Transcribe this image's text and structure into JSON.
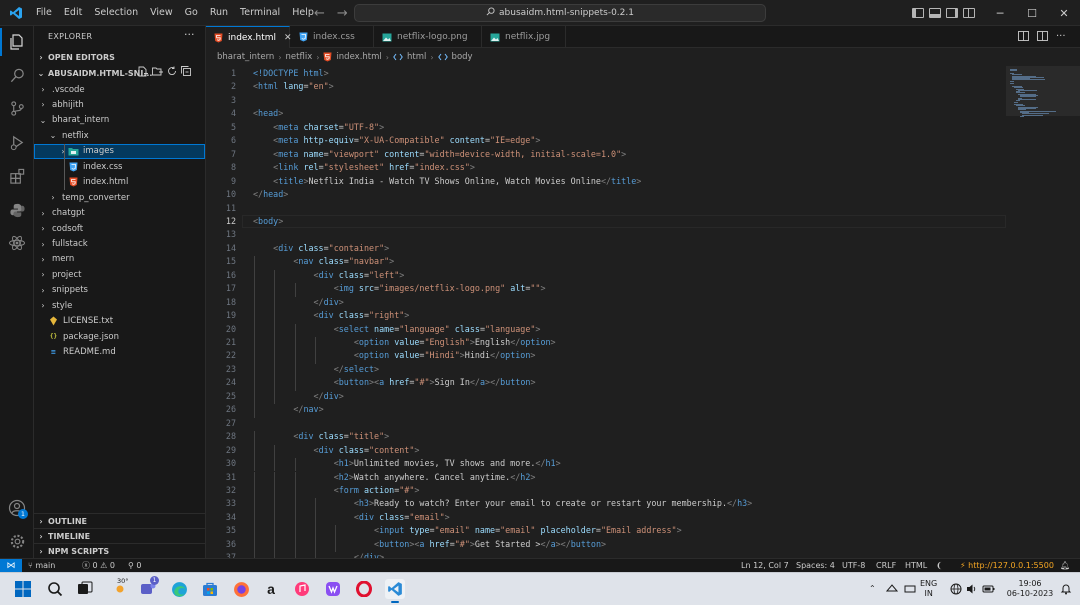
{
  "menu": [
    "File",
    "Edit",
    "Selection",
    "View",
    "Go",
    "Run",
    "Terminal",
    "Help"
  ],
  "command_center": "abusaidm.html-snippets-0.2.1",
  "sidebar": {
    "title": "EXPLORER",
    "open_editors": "OPEN EDITORS",
    "root": "ABUSAIDM.HTML-SNI...",
    "tree": [
      {
        "label": ".vscode",
        "kind": "folder",
        "depth": 1,
        "open": false
      },
      {
        "label": "abhijith",
        "kind": "folder",
        "depth": 1,
        "open": false
      },
      {
        "label": "bharat_intern",
        "kind": "folder",
        "depth": 1,
        "open": true
      },
      {
        "label": "netflix",
        "kind": "folder",
        "depth": 2,
        "open": true
      },
      {
        "label": "images",
        "kind": "images",
        "depth": 3,
        "open": false,
        "selected": true
      },
      {
        "label": "index.css",
        "kind": "css",
        "depth": 3
      },
      {
        "label": "index.html",
        "kind": "html",
        "depth": 3
      },
      {
        "label": "temp_converter",
        "kind": "folder",
        "depth": 2,
        "open": false
      },
      {
        "label": "chatgpt",
        "kind": "folder",
        "depth": 1,
        "open": false
      },
      {
        "label": "codsoft",
        "kind": "folder",
        "depth": 1,
        "open": false
      },
      {
        "label": "fullstack",
        "kind": "folder",
        "depth": 1,
        "open": false
      },
      {
        "label": "mern",
        "kind": "folder",
        "depth": 1,
        "open": false
      },
      {
        "label": "project",
        "kind": "folder",
        "depth": 1,
        "open": false
      },
      {
        "label": "snippets",
        "kind": "folder",
        "depth": 1,
        "open": false
      },
      {
        "label": "style",
        "kind": "folder",
        "depth": 1,
        "open": false
      },
      {
        "label": "LICENSE.txt",
        "kind": "license",
        "depth": 1
      },
      {
        "label": "package.json",
        "kind": "json",
        "depth": 1
      },
      {
        "label": "README.md",
        "kind": "md",
        "depth": 1
      }
    ],
    "outline": "OUTLINE",
    "timeline": "TIMELINE",
    "npm_scripts": "NPM SCRIPTS"
  },
  "tabs": [
    {
      "label": "index.html",
      "kind": "html",
      "active": true
    },
    {
      "label": "index.css",
      "kind": "css",
      "active": false
    },
    {
      "label": "netflix-logo.png",
      "kind": "img",
      "active": false
    },
    {
      "label": "netflix.jpg",
      "kind": "img",
      "active": false
    }
  ],
  "breadcrumb": [
    "bharat_intern",
    "netflix",
    "index.html",
    "html",
    "body"
  ],
  "code": [
    [
      [
        "doc",
        "<!DOCTYPE "
      ],
      [
        "tag",
        "html"
      ],
      [
        "brk",
        ">"
      ]
    ],
    [
      [
        "brk",
        "<"
      ],
      [
        "tag",
        "html "
      ],
      [
        "attr",
        "lang"
      ],
      [
        "text",
        "="
      ],
      [
        "str",
        "\"en\""
      ],
      [
        "brk",
        ">"
      ]
    ],
    [],
    [
      [
        "brk",
        "<"
      ],
      [
        "tag",
        "head"
      ],
      [
        "brk",
        ">"
      ]
    ],
    [
      [
        "text",
        "    "
      ],
      [
        "brk",
        "<"
      ],
      [
        "tag",
        "meta "
      ],
      [
        "attr",
        "charset"
      ],
      [
        "text",
        "="
      ],
      [
        "str",
        "\"UTF-8\""
      ],
      [
        "brk",
        ">"
      ]
    ],
    [
      [
        "text",
        "    "
      ],
      [
        "brk",
        "<"
      ],
      [
        "tag",
        "meta "
      ],
      [
        "attr",
        "http-equiv"
      ],
      [
        "text",
        "="
      ],
      [
        "str",
        "\"X-UA-Compatible\""
      ],
      [
        "attr",
        " content"
      ],
      [
        "text",
        "="
      ],
      [
        "str",
        "\"IE=edge\""
      ],
      [
        "brk",
        ">"
      ]
    ],
    [
      [
        "text",
        "    "
      ],
      [
        "brk",
        "<"
      ],
      [
        "tag",
        "meta "
      ],
      [
        "attr",
        "name"
      ],
      [
        "text",
        "="
      ],
      [
        "str",
        "\"viewport\""
      ],
      [
        "attr",
        " content"
      ],
      [
        "text",
        "="
      ],
      [
        "str",
        "\"width=device-width, initial-scale=1.0\""
      ],
      [
        "brk",
        ">"
      ]
    ],
    [
      [
        "text",
        "    "
      ],
      [
        "brk",
        "<"
      ],
      [
        "tag",
        "link "
      ],
      [
        "attr",
        "rel"
      ],
      [
        "text",
        "="
      ],
      [
        "str",
        "\"stylesheet\""
      ],
      [
        "attr",
        " href"
      ],
      [
        "text",
        "="
      ],
      [
        "str",
        "\"index.css\""
      ],
      [
        "brk",
        ">"
      ]
    ],
    [
      [
        "text",
        "    "
      ],
      [
        "brk",
        "<"
      ],
      [
        "tag",
        "title"
      ],
      [
        "brk",
        ">"
      ],
      [
        "text",
        "Netflix India - Watch TV Shows Online, Watch Movies Online"
      ],
      [
        "brk",
        "</"
      ],
      [
        "tag",
        "title"
      ],
      [
        "brk",
        ">"
      ]
    ],
    [
      [
        "brk",
        "</"
      ],
      [
        "tag",
        "head"
      ],
      [
        "brk",
        ">"
      ]
    ],
    [],
    [
      [
        "brk",
        "<"
      ],
      [
        "tag",
        "body"
      ],
      [
        "brk",
        ">"
      ]
    ],
    [],
    [
      [
        "text",
        "    "
      ],
      [
        "brk",
        "<"
      ],
      [
        "tag",
        "div "
      ],
      [
        "attr",
        "class"
      ],
      [
        "text",
        "="
      ],
      [
        "str",
        "\"container\""
      ],
      [
        "brk",
        ">"
      ]
    ],
    [
      [
        "text",
        "        "
      ],
      [
        "brk",
        "<"
      ],
      [
        "tag",
        "nav "
      ],
      [
        "attr",
        "class"
      ],
      [
        "text",
        "="
      ],
      [
        "str",
        "\"navbar\""
      ],
      [
        "brk",
        ">"
      ]
    ],
    [
      [
        "text",
        "            "
      ],
      [
        "brk",
        "<"
      ],
      [
        "tag",
        "div "
      ],
      [
        "attr",
        "class"
      ],
      [
        "text",
        "="
      ],
      [
        "str",
        "\"left\""
      ],
      [
        "brk",
        ">"
      ]
    ],
    [
      [
        "text",
        "                "
      ],
      [
        "brk",
        "<"
      ],
      [
        "tag",
        "img "
      ],
      [
        "attr",
        "src"
      ],
      [
        "text",
        "="
      ],
      [
        "str",
        "\"images/netflix-logo.png\""
      ],
      [
        "attr",
        " alt"
      ],
      [
        "text",
        "="
      ],
      [
        "str",
        "\"\""
      ],
      [
        "brk",
        ">"
      ]
    ],
    [
      [
        "text",
        "            "
      ],
      [
        "brk",
        "</"
      ],
      [
        "tag",
        "div"
      ],
      [
        "brk",
        ">"
      ]
    ],
    [
      [
        "text",
        "            "
      ],
      [
        "brk",
        "<"
      ],
      [
        "tag",
        "div "
      ],
      [
        "attr",
        "class"
      ],
      [
        "text",
        "="
      ],
      [
        "str",
        "\"right\""
      ],
      [
        "brk",
        ">"
      ]
    ],
    [
      [
        "text",
        "                "
      ],
      [
        "brk",
        "<"
      ],
      [
        "tag",
        "select "
      ],
      [
        "attr",
        "name"
      ],
      [
        "text",
        "="
      ],
      [
        "str",
        "\"language\""
      ],
      [
        "attr",
        " class"
      ],
      [
        "text",
        "="
      ],
      [
        "str",
        "\"language\""
      ],
      [
        "brk",
        ">"
      ]
    ],
    [
      [
        "text",
        "                    "
      ],
      [
        "brk",
        "<"
      ],
      [
        "tag",
        "option "
      ],
      [
        "attr",
        "value"
      ],
      [
        "text",
        "="
      ],
      [
        "str",
        "\"English\""
      ],
      [
        "brk",
        ">"
      ],
      [
        "text",
        "English"
      ],
      [
        "brk",
        "</"
      ],
      [
        "tag",
        "option"
      ],
      [
        "brk",
        ">"
      ]
    ],
    [
      [
        "text",
        "                    "
      ],
      [
        "brk",
        "<"
      ],
      [
        "tag",
        "option "
      ],
      [
        "attr",
        "value"
      ],
      [
        "text",
        "="
      ],
      [
        "str",
        "\"Hindi\""
      ],
      [
        "brk",
        ">"
      ],
      [
        "text",
        "Hindi"
      ],
      [
        "brk",
        "</"
      ],
      [
        "tag",
        "option"
      ],
      [
        "brk",
        ">"
      ]
    ],
    [
      [
        "text",
        "                "
      ],
      [
        "brk",
        "</"
      ],
      [
        "tag",
        "select"
      ],
      [
        "brk",
        ">"
      ]
    ],
    [
      [
        "text",
        "                "
      ],
      [
        "brk",
        "<"
      ],
      [
        "tag",
        "button"
      ],
      [
        "brk",
        "><"
      ],
      [
        "tag",
        "a "
      ],
      [
        "attr",
        "href"
      ],
      [
        "text",
        "="
      ],
      [
        "str",
        "\"#\""
      ],
      [
        "brk",
        ">"
      ],
      [
        "text",
        "Sign In"
      ],
      [
        "brk",
        "</"
      ],
      [
        "tag",
        "a"
      ],
      [
        "brk",
        "></"
      ],
      [
        "tag",
        "button"
      ],
      [
        "brk",
        ">"
      ]
    ],
    [
      [
        "text",
        "            "
      ],
      [
        "brk",
        "</"
      ],
      [
        "tag",
        "div"
      ],
      [
        "brk",
        ">"
      ]
    ],
    [
      [
        "text",
        "        "
      ],
      [
        "brk",
        "</"
      ],
      [
        "tag",
        "nav"
      ],
      [
        "brk",
        ">"
      ]
    ],
    [],
    [
      [
        "text",
        "        "
      ],
      [
        "brk",
        "<"
      ],
      [
        "tag",
        "div "
      ],
      [
        "attr",
        "class"
      ],
      [
        "text",
        "="
      ],
      [
        "str",
        "\"title\""
      ],
      [
        "brk",
        ">"
      ]
    ],
    [
      [
        "text",
        "            "
      ],
      [
        "brk",
        "<"
      ],
      [
        "tag",
        "div "
      ],
      [
        "attr",
        "class"
      ],
      [
        "text",
        "="
      ],
      [
        "str",
        "\"content\""
      ],
      [
        "brk",
        ">"
      ]
    ],
    [
      [
        "text",
        "                "
      ],
      [
        "brk",
        "<"
      ],
      [
        "tag",
        "h1"
      ],
      [
        "brk",
        ">"
      ],
      [
        "text",
        "Unlimited movies, TV shows and more."
      ],
      [
        "brk",
        "</"
      ],
      [
        "tag",
        "h1"
      ],
      [
        "brk",
        ">"
      ]
    ],
    [
      [
        "text",
        "                "
      ],
      [
        "brk",
        "<"
      ],
      [
        "tag",
        "h2"
      ],
      [
        "brk",
        ">"
      ],
      [
        "text",
        "Watch anywhere. Cancel anytime."
      ],
      [
        "brk",
        "</"
      ],
      [
        "tag",
        "h2"
      ],
      [
        "brk",
        ">"
      ]
    ],
    [
      [
        "text",
        "                "
      ],
      [
        "brk",
        "<"
      ],
      [
        "tag",
        "form "
      ],
      [
        "attr",
        "action"
      ],
      [
        "text",
        "="
      ],
      [
        "str",
        "\"#\""
      ],
      [
        "brk",
        ">"
      ]
    ],
    [
      [
        "text",
        "                    "
      ],
      [
        "brk",
        "<"
      ],
      [
        "tag",
        "h3"
      ],
      [
        "brk",
        ">"
      ],
      [
        "text",
        "Ready to watch? Enter your email to create or restart your membership."
      ],
      [
        "brk",
        "</"
      ],
      [
        "tag",
        "h3"
      ],
      [
        "brk",
        ">"
      ]
    ],
    [
      [
        "text",
        "                    "
      ],
      [
        "brk",
        "<"
      ],
      [
        "tag",
        "div "
      ],
      [
        "attr",
        "class"
      ],
      [
        "text",
        "="
      ],
      [
        "str",
        "\"email\""
      ],
      [
        "brk",
        ">"
      ]
    ],
    [
      [
        "text",
        "                        "
      ],
      [
        "brk",
        "<"
      ],
      [
        "tag",
        "input "
      ],
      [
        "attr",
        "type"
      ],
      [
        "text",
        "="
      ],
      [
        "str",
        "\"email\""
      ],
      [
        "attr",
        " name"
      ],
      [
        "text",
        "="
      ],
      [
        "str",
        "\"email\""
      ],
      [
        "attr",
        " placeholder"
      ],
      [
        "text",
        "="
      ],
      [
        "str",
        "\"Email address\""
      ],
      [
        "brk",
        ">"
      ]
    ],
    [
      [
        "text",
        "                        "
      ],
      [
        "brk",
        "<"
      ],
      [
        "tag",
        "button"
      ],
      [
        "brk",
        "><"
      ],
      [
        "tag",
        "a "
      ],
      [
        "attr",
        "href"
      ],
      [
        "text",
        "="
      ],
      [
        "str",
        "\"#\""
      ],
      [
        "brk",
        ">"
      ],
      [
        "text",
        "Get Started >"
      ],
      [
        "brk",
        "</"
      ],
      [
        "tag",
        "a"
      ],
      [
        "brk",
        "></"
      ],
      [
        "tag",
        "button"
      ],
      [
        "brk",
        ">"
      ]
    ],
    [
      [
        "text",
        "                    "
      ],
      [
        "brk",
        "</"
      ],
      [
        "tag",
        "div"
      ],
      [
        "brk",
        ">"
      ]
    ]
  ],
  "current_line": 12,
  "status": {
    "branch": "main",
    "errors": "0",
    "warnings": "0",
    "ports": "0",
    "position": "Ln 12, Col 7",
    "spaces": "Spaces: 4",
    "encoding": "UTF-8",
    "eol": "CRLF",
    "language": "HTML",
    "go_live": "http://127.0.0.1:5500"
  },
  "taskbar": {
    "weather": "30°",
    "chat_badge": "1",
    "lang_top": "ENG",
    "lang_bottom": "IN",
    "time": "19:06",
    "date": "06-10-2023"
  },
  "accounts_badge": "1",
  "colors": {
    "accent": "#0078d4",
    "selection": "#04395e",
    "tag": "#569cd6",
    "attr": "#9cdcfe",
    "string": "#ce9178"
  }
}
